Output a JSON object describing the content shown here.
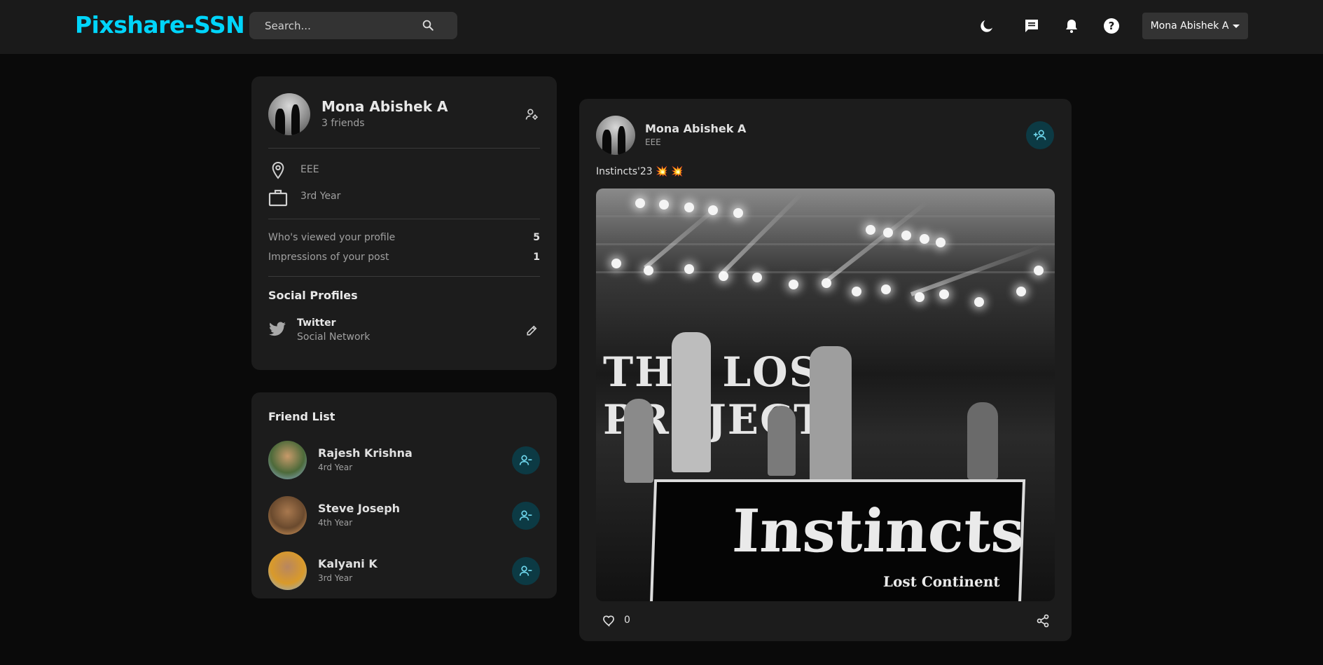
{
  "navbar": {
    "logo": "Pixshare-SSN",
    "search_placeholder": "Search...",
    "icons": [
      "moon-icon",
      "chat-icon",
      "bell-icon",
      "help-icon"
    ],
    "user_name": "Mona Abishek A"
  },
  "profile": {
    "name": "Mona Abishek A",
    "friends": "3 friends",
    "location": "EEE",
    "occupation": "3rd Year",
    "stats": [
      {
        "label": "Who's viewed your profile",
        "value": "5"
      },
      {
        "label": "Impressions of your post",
        "value": "1"
      }
    ],
    "social_title": "Social Profiles",
    "social": {
      "name": "Twitter",
      "type": "Social Network"
    }
  },
  "friends": {
    "title": "Friend List",
    "items": [
      {
        "name": "Rajesh Krishna",
        "year": "4rd Year"
      },
      {
        "name": "Steve Joseph",
        "year": "4th Year"
      },
      {
        "name": "Kalyani K",
        "year": "3rd Year"
      }
    ]
  },
  "post": {
    "author": "Mona Abishek A",
    "location": "EEE",
    "caption": "Instincts'23 💥 💥",
    "image_text": {
      "banner": "THE LOST PROJECT",
      "board_title": "Instincts",
      "board_subtitle": "Lost Continent"
    },
    "likes": "0"
  },
  "colors": {
    "brand": "#00d5fa",
    "accent_button_bg": "#0c3a44",
    "accent_button_icon": "#6fd8ee",
    "background": "#0a0a0a",
    "card": "#1c1c1c",
    "navbar": "#1a1a1a"
  }
}
